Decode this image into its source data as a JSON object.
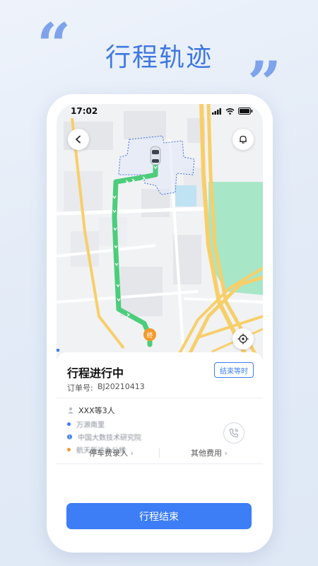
{
  "promo": {
    "title": "行程轨迹",
    "quote_open": "“",
    "quote_close": "”"
  },
  "status_bar": {
    "time": "17:02",
    "icons": [
      "signal-icon",
      "wifi-icon",
      "battery-icon"
    ]
  },
  "map": {
    "pin_label": "终",
    "icons": [
      "back-icon",
      "bell-icon",
      "locate-icon",
      "car-icon"
    ]
  },
  "trip": {
    "title": "行程进行中",
    "order_label": "订单号:",
    "order_number": "BJ20210413",
    "end_wait_label": "结束等时",
    "passenger": "XXX等3人",
    "stops": [
      {
        "label": "万源南里",
        "color": "#3d7df5"
      },
      {
        "label": "中国大数技术研究院",
        "color": "#3d7df5"
      },
      {
        "label": "航天新达办公楼",
        "color": "#f39a2b"
      }
    ],
    "parking_fee_label": "停车费录入",
    "other_fee_label": "其他费用",
    "finish_button_label": "行程结束"
  },
  "colors": {
    "accent": "#3d7df5",
    "route": "#4ccd7b",
    "end_pin": "#f39a2b",
    "park": "#a8e6c8",
    "road": "#f7cf6a"
  }
}
